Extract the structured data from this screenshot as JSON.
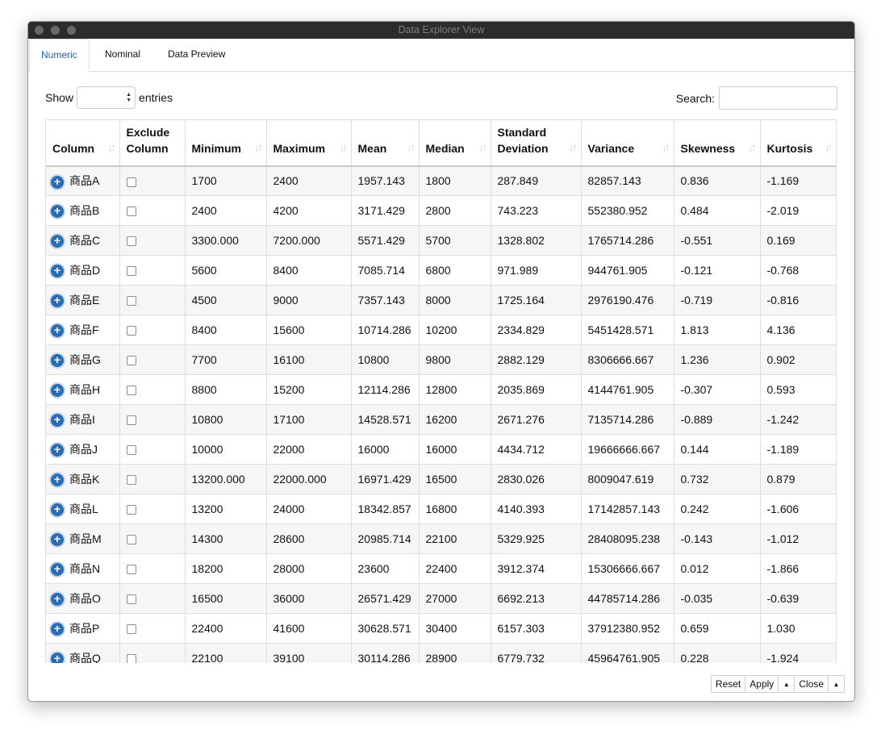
{
  "window": {
    "title": "Data Explorer View"
  },
  "tabs": [
    {
      "label": "Numeric",
      "active": true
    },
    {
      "label": "Nominal",
      "active": false
    },
    {
      "label": "Data Preview",
      "active": false
    }
  ],
  "controls": {
    "show_label": "Show",
    "entries_label": "entries",
    "show_value": "",
    "search_label": "Search:",
    "search_value": ""
  },
  "table": {
    "columns": [
      "Column",
      "Exclude Column",
      "Minimum",
      "Maximum",
      "Mean",
      "Median",
      "Standard Deviation",
      "Variance",
      "Skewness",
      "Kurtosis"
    ],
    "rows": [
      [
        "商品A",
        "1700",
        "2400",
        "1957.143",
        "1800",
        "287.849",
        "82857.143",
        "0.836",
        "-1.169"
      ],
      [
        "商品B",
        "2400",
        "4200",
        "3171.429",
        "2800",
        "743.223",
        "552380.952",
        "0.484",
        "-2.019"
      ],
      [
        "商品C",
        "3300.000",
        "7200.000",
        "5571.429",
        "5700",
        "1328.802",
        "1765714.286",
        "-0.551",
        "0.169"
      ],
      [
        "商品D",
        "5600",
        "8400",
        "7085.714",
        "6800",
        "971.989",
        "944761.905",
        "-0.121",
        "-0.768"
      ],
      [
        "商品E",
        "4500",
        "9000",
        "7357.143",
        "8000",
        "1725.164",
        "2976190.476",
        "-0.719",
        "-0.816"
      ],
      [
        "商品F",
        "8400",
        "15600",
        "10714.286",
        "10200",
        "2334.829",
        "5451428.571",
        "1.813",
        "4.136"
      ],
      [
        "商品G",
        "7700",
        "16100",
        "10800",
        "9800",
        "2882.129",
        "8306666.667",
        "1.236",
        "0.902"
      ],
      [
        "商品H",
        "8800",
        "15200",
        "12114.286",
        "12800",
        "2035.869",
        "4144761.905",
        "-0.307",
        "0.593"
      ],
      [
        "商品I",
        "10800",
        "17100",
        "14528.571",
        "16200",
        "2671.276",
        "7135714.286",
        "-0.889",
        "-1.242"
      ],
      [
        "商品J",
        "10000",
        "22000",
        "16000",
        "16000",
        "4434.712",
        "19666666.667",
        "0.144",
        "-1.189"
      ],
      [
        "商品K",
        "13200.000",
        "22000.000",
        "16971.429",
        "16500",
        "2830.026",
        "8009047.619",
        "0.732",
        "0.879"
      ],
      [
        "商品L",
        "13200",
        "24000",
        "18342.857",
        "16800",
        "4140.393",
        "17142857.143",
        "0.242",
        "-1.606"
      ],
      [
        "商品M",
        "14300",
        "28600",
        "20985.714",
        "22100",
        "5329.925",
        "28408095.238",
        "-0.143",
        "-1.012"
      ],
      [
        "商品N",
        "18200",
        "28000",
        "23600",
        "22400",
        "3912.374",
        "15306666.667",
        "0.012",
        "-1.866"
      ],
      [
        "商品O",
        "16500",
        "36000",
        "26571.429",
        "27000",
        "6692.213",
        "44785714.286",
        "-0.035",
        "-0.639"
      ],
      [
        "商品P",
        "22400",
        "41600",
        "30628.571",
        "30400",
        "6157.303",
        "37912380.952",
        "0.659",
        "1.030"
      ],
      [
        "商品Q",
        "22100",
        "39100",
        "30114.286",
        "28900",
        "6779.732",
        "45964761.905",
        "0.228",
        "-1.924"
      ]
    ]
  },
  "footer": {
    "reset_label": "Reset",
    "apply_label": "Apply",
    "close_label": "Close",
    "caret_glyph": "▲"
  },
  "colors": {
    "accent": "#2a6db3",
    "titlebar": "#2d2b2b"
  }
}
